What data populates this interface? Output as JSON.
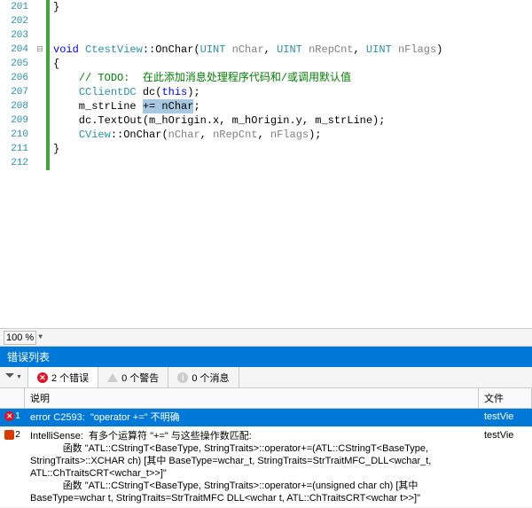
{
  "zoom": "100 %",
  "lines": [
    {
      "n": "201",
      "fold": "",
      "html": "}"
    },
    {
      "n": "202",
      "fold": "",
      "html": ""
    },
    {
      "n": "203",
      "fold": "",
      "html": ""
    },
    {
      "n": "204",
      "fold": "⊟",
      "html": "<span class='kw'>void</span> <span class='cls'>CtestView</span>::OnChar(<span class='cls'>UINT</span> <span class='param'>nChar</span>, <span class='cls'>UINT</span> <span class='param'>nRepCnt</span>, <span class='cls'>UINT</span> <span class='param'>nFlags</span>)"
    },
    {
      "n": "205",
      "fold": "",
      "html": "{"
    },
    {
      "n": "206",
      "fold": "",
      "html": "    <span class='cmt'>// TODO:  在此添加消息处理程序代码和/或调用默认值</span>"
    },
    {
      "n": "207",
      "fold": "",
      "html": "    <span class='cls'>CClientDC</span> dc(<span class='kw'>this</span>);"
    },
    {
      "n": "208",
      "fold": "",
      "html": "    m_strLine <span class='highlight'>+= nChar</span>;"
    },
    {
      "n": "209",
      "fold": "",
      "html": "    dc.TextOut(m_hOrigin.x, m_hOrigin.y, m_strLine);"
    },
    {
      "n": "210",
      "fold": "",
      "html": "    <span class='cls'>CView</span>::OnChar(<span class='param'>nChar</span>, <span class='param'>nRepCnt</span>, <span class='param'>nFlags</span>);"
    },
    {
      "n": "211",
      "fold": "",
      "html": "}"
    },
    {
      "n": "212",
      "fold": "",
      "html": ""
    }
  ],
  "errorPanel": {
    "title": "错误列表",
    "tabs": {
      "errors": "2 个错误",
      "warnings": "0 个警告",
      "messages": "0 个消息"
    },
    "columns": {
      "desc": "说明",
      "file": "文件"
    },
    "rows": [
      {
        "num": "1",
        "icon": "err",
        "desc": "error C2593:  \"operator +=\" 不明确",
        "file": "testVie",
        "selected": true
      },
      {
        "num": "2",
        "icon": "intel",
        "desc": "IntelliSense:  有多个运算符 \"+=\" 与这些操作数匹配:\n            函数 \"ATL::CStringT<BaseType, StringTraits>::operator+=(ATL::CStringT<BaseType, StringTraits>::XCHAR ch) [其中 BaseType=wchar_t, StringTraits=StrTraitMFC_DLL<wchar_t, ATL::ChTraitsCRT<wchar_t>>]\"\n            函数 \"ATL::CStringT<BaseType, StringTraits>::operator+=(unsigned char ch) [其中 BaseType=wchar t, StringTraits=StrTraitMFC DLL<wchar t, ATL::ChTraitsCRT<wchar t>>]\"",
        "file": "testVie",
        "selected": false
      }
    ]
  }
}
